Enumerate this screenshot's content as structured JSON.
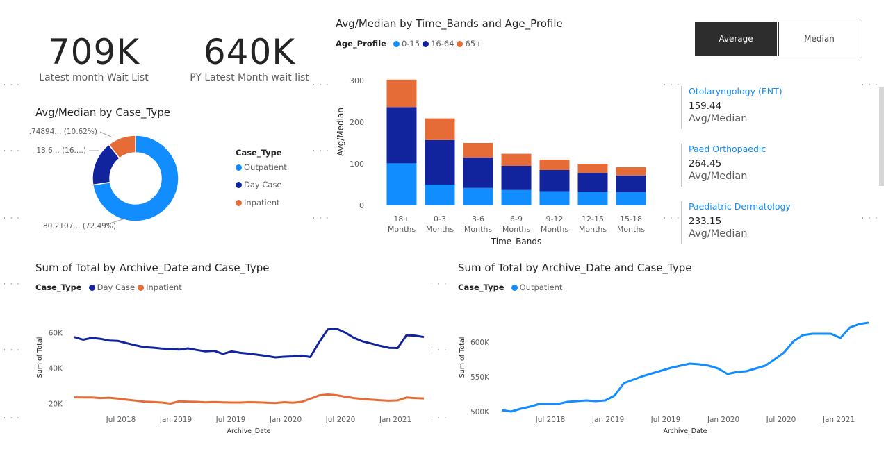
{
  "kpis": [
    {
      "value": "709K",
      "label": "Latest month Wait List"
    },
    {
      "value": "640K",
      "label": "PY Latest Month wait list"
    }
  ],
  "toggle": {
    "average": "Average",
    "median": "Median",
    "selected": "Average"
  },
  "cards": [
    {
      "name": "Otolaryngology (ENT)",
      "value": "159.44",
      "label": "Avg/Median"
    },
    {
      "name": "Paed Orthopaedic",
      "value": "264.45",
      "label": "Avg/Median"
    },
    {
      "name": "Paediatric Dermatology",
      "value": "233.15",
      "label": "Avg/Median"
    }
  ],
  "colors": {
    "outpatient": "#118dff",
    "day_case": "#12239e",
    "inpatient": "#e66c37",
    "age_0_15": "#118dff",
    "age_16_64": "#12239e",
    "age_65": "#e66c37"
  },
  "chart_data": [
    {
      "type": "pie",
      "title": "Avg/Median by Case_Type",
      "legend_title": "Case_Type",
      "categories": [
        "Outpatient",
        "Day Case",
        "Inpatient"
      ],
      "values": [
        80.2107,
        18.6,
        11.74894
      ],
      "data_labels": [
        "80.2107... (72.49%)",
        "18.6... (16....)",
        "11.74894... (10.62%)"
      ],
      "legend_position": "right"
    },
    {
      "type": "bar",
      "stacked": true,
      "title": "Avg/Median by Time_Bands and Age_Profile",
      "legend_title": "Age_Profile",
      "xlabel": "Time_Bands",
      "ylabel": "Avg/Median",
      "categories": [
        "18+ Months",
        "0-3 Months",
        "3-6 Months",
        "6-9 Months",
        "9-12 Months",
        "12-15 Months",
        "15-18 Months"
      ],
      "series": [
        {
          "name": "0-15",
          "values": [
            101,
            50,
            42,
            37,
            34,
            33,
            32
          ]
        },
        {
          "name": "16-64",
          "values": [
            135,
            107,
            73,
            58,
            51,
            45,
            40
          ]
        },
        {
          "name": "65+",
          "values": [
            66,
            52,
            35,
            29,
            25,
            22,
            20
          ]
        }
      ],
      "ylim": [
        0,
        300
      ],
      "yticks": [
        "0",
        "100",
        "200",
        "300"
      ],
      "legend_position": "top-left"
    },
    {
      "type": "line",
      "title": "Sum of Total by Archive_Date and Case_Type",
      "legend_title": "Case_Type",
      "xlabel": "Archive_Date",
      "ylabel": "Sum of Total",
      "x": [
        "2018-03",
        "2018-04",
        "2018-05",
        "2018-06",
        "2018-07",
        "2018-08",
        "2018-09",
        "2018-10",
        "2018-11",
        "2018-12",
        "2019-01",
        "2019-02",
        "2019-03",
        "2019-04",
        "2019-05",
        "2019-06",
        "2019-07",
        "2019-08",
        "2019-09",
        "2019-10",
        "2019-11",
        "2019-12",
        "2020-01",
        "2020-02",
        "2020-03",
        "2020-04",
        "2020-05",
        "2020-06",
        "2020-07",
        "2020-08",
        "2020-09",
        "2020-10",
        "2020-11",
        "2020-12",
        "2021-01",
        "2021-02",
        "2021-03",
        "2021-04"
      ],
      "series": [
        {
          "name": "Day Case",
          "values": [
            57.5,
            56.0,
            57.0,
            56.5,
            55.5,
            55.3,
            54.0,
            52.8,
            51.8,
            51.5,
            51.0,
            50.7,
            50.4,
            51.1,
            50.2,
            49.4,
            49.7,
            48.0,
            49.4,
            48.6,
            48.1,
            47.5,
            46.8,
            46.0,
            46.4,
            46.6,
            47.0,
            46.2,
            54.5,
            61.8,
            62.2,
            60.0,
            57.0,
            55.0,
            53.8,
            52.5,
            51.4,
            51.3,
            58.5,
            58.3,
            57.5
          ]
        },
        {
          "name": "Inpatient",
          "values": [
            23.4,
            23.3,
            23.3,
            23.0,
            23.2,
            22.7,
            22.1,
            21.6,
            21.0,
            20.8,
            20.5,
            19.9,
            21.2,
            21.0,
            20.9,
            20.6,
            20.8,
            20.6,
            20.5,
            20.5,
            20.7,
            20.6,
            20.4,
            20.2,
            20.7,
            20.4,
            20.9,
            22.6,
            24.5,
            25.0,
            24.6,
            23.8,
            23.0,
            22.5,
            22.1,
            21.8,
            21.5,
            21.7,
            23.3,
            23.0,
            22.8
          ]
        }
      ],
      "yticks": [
        "20K",
        "40K",
        "60K"
      ],
      "ylim": [
        15,
        66
      ],
      "xticks": [
        "Jul 2018",
        "Jan 2019",
        "Jul 2019",
        "Jan 2020",
        "Jul 2020",
        "Jan 2021"
      ],
      "legend_position": "top-left"
    },
    {
      "type": "line",
      "title": "Sum of Total by Archive_Date and Case_Type",
      "legend_title": "Case_Type",
      "xlabel": "Archive_Date",
      "ylabel": "Sum of Total",
      "series": [
        {
          "name": "Outpatient",
          "values": [
            502,
            500,
            504,
            507,
            511,
            511,
            511,
            514,
            515,
            516,
            515,
            516,
            523,
            541,
            546,
            551,
            555,
            559,
            563,
            566,
            569,
            568,
            566,
            562,
            554,
            557,
            558,
            562,
            566,
            575,
            585,
            601,
            610,
            612,
            612,
            612,
            606,
            621,
            626,
            628
          ]
        }
      ],
      "yticks": [
        "500K",
        "550K",
        "600K"
      ],
      "ylim": [
        495,
        637
      ],
      "xticks": [
        "Jul 2018",
        "Jan 2019",
        "Jul 2019",
        "Jan 2020",
        "Jul 2020",
        "Jan 2021"
      ],
      "legend_position": "top-left"
    }
  ]
}
